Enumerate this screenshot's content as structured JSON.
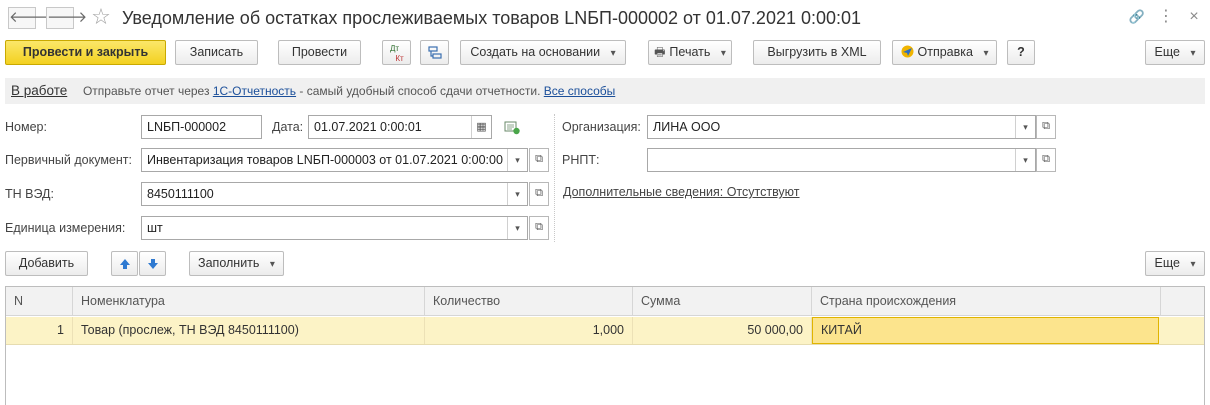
{
  "window": {
    "title": "Уведомление об остатках прослеживаемых товаров LNБП-000002 от 01.07.2021 0:00:01",
    "icons": [
      "back-arrow-icon",
      "forward-arrow-icon",
      "star-icon",
      "link-icon",
      "more-icon",
      "close-icon"
    ],
    "glyphs": {
      "back": "🡐",
      "forward": "🡒",
      "star": "☆",
      "link": "🔗",
      "more": "⋮",
      "close": "×"
    }
  },
  "toolbar": {
    "post_close": "Провести и закрыть",
    "save": "Записать",
    "post": "Провести",
    "dtkt_top": "Дт",
    "dtkt_bottom": "Кт",
    "create_based": "Создать на основании",
    "print": "Печать",
    "export_xml": "Выгрузить в XML",
    "send": "Отправка",
    "help": "?",
    "more": "Еще"
  },
  "info": {
    "status": "В работе",
    "text_before": "Отправьте отчет через",
    "link_1c": "1С-Отчетность",
    "text_after": "- самый удобный способ сдачи отчетности.",
    "link_all": "Все способы"
  },
  "form": {
    "number_label": "Номер:",
    "number_value": "LNБП-000002",
    "date_label": "Дата:",
    "date_value": "01.07.2021  0:00:01",
    "primary_doc_label": "Первичный документ:",
    "primary_doc_value": "Инвентаризация товаров LNБП-000003 от 01.07.2021 0:00:00",
    "tnved_label": "ТН ВЭД:",
    "tnved_value": "8450111100",
    "unit_label": "Единица измерения:",
    "unit_value": "шт",
    "org_label": "Организация:",
    "org_value": "ЛИНА ООО",
    "rnpt_label": "РНПТ:",
    "rnpt_value": "",
    "extra_info_link": "Дополнительные сведения: Отсутствуют"
  },
  "table_toolbar": {
    "add": "Добавить",
    "fill": "Заполнить",
    "more": "Еще"
  },
  "table": {
    "columns": [
      "N",
      "Номенклатура",
      "Количество",
      "Сумма",
      "Страна происхождения"
    ],
    "rows": [
      {
        "n": "1",
        "item": "Товар (прослеж, ТН ВЭД 8450111100)",
        "qty": "1,000",
        "sum": "50 000,00",
        "country": "КИТАЙ"
      }
    ]
  },
  "colors": {
    "primary_button": "#f3d120",
    "link": "#1b4f9a",
    "selected_row": "#fcf3c6",
    "selected_cell": "#fce48d"
  }
}
